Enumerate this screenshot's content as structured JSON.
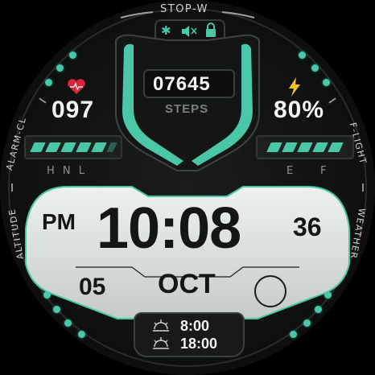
{
  "top_label": "STOP-W",
  "status_icons": [
    "bluetooth-icon",
    "mute-icon",
    "lock-icon"
  ],
  "left_label": "ALARM-CL",
  "left_lower_label": "ALTITUDE",
  "right_label": "F-LIGHT",
  "right_lower_label": "WEATHER",
  "heart_rate": "097",
  "battery": "80%",
  "steps_value": "07645",
  "steps_label": "STEPS",
  "hr_scale": "H N L",
  "battery_scale_e": "E",
  "battery_scale_f": "F",
  "ampm": "PM",
  "time": "10:08",
  "seconds": "36",
  "day": "05",
  "month": "OCT",
  "sunrise": "8:00",
  "sunset": "18:00",
  "colors": {
    "accent": "#49c7a6",
    "lcd": "#dfe3e0",
    "text": "#f2f4f3"
  },
  "hr_bar_level": 0.8,
  "battery_bar_level": 0.8
}
